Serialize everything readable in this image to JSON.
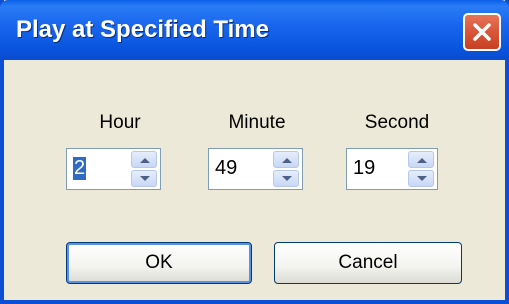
{
  "window": {
    "title": "Play at Specified Time"
  },
  "fields": [
    {
      "label": "Hour",
      "value": "2"
    },
    {
      "label": "Minute",
      "value": "49"
    },
    {
      "label": "Second",
      "value": "19"
    }
  ],
  "buttons": {
    "ok": "OK",
    "cancel": "Cancel"
  }
}
